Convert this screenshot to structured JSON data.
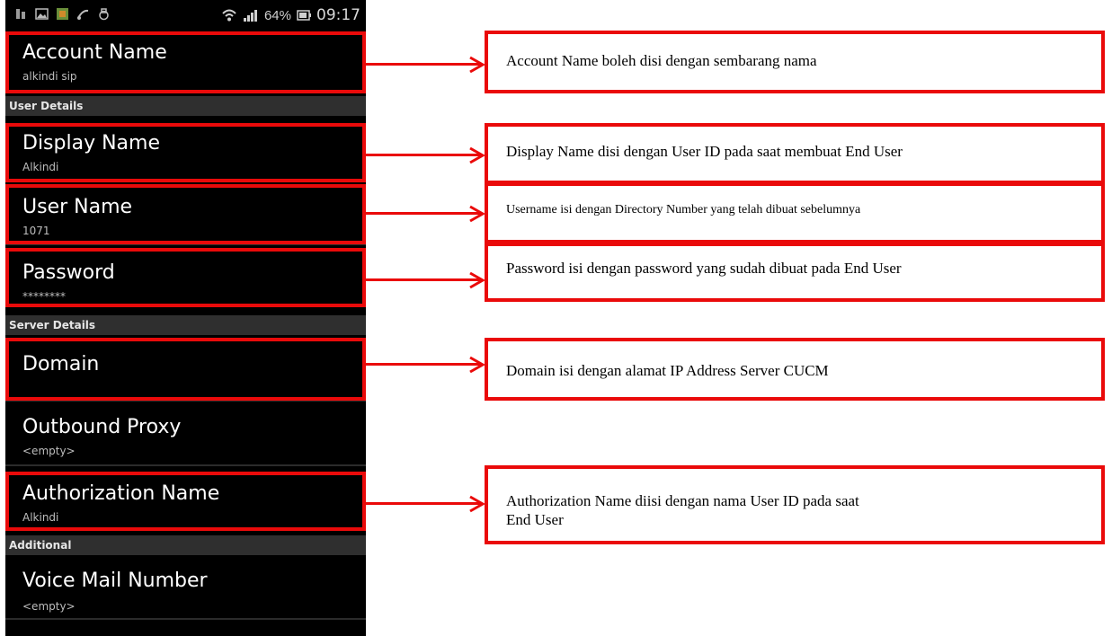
{
  "status_bar": {
    "battery_percent": "64%",
    "time": "09:17",
    "left_icons": [
      "notification-icon",
      "image-icon",
      "app-icon",
      "network-icon",
      "lock-icon"
    ]
  },
  "settings": {
    "account_name": {
      "title": "Account Name",
      "value": "alkindi sip"
    },
    "section_user": "User Details",
    "display_name": {
      "title": "Display Name",
      "value": "Alkindi"
    },
    "user_name": {
      "title": "User Name",
      "value": "1071"
    },
    "password": {
      "title": "Password",
      "value": "********"
    },
    "section_server": "Server Details",
    "domain": {
      "title": "Domain",
      "value": ""
    },
    "outbound_proxy": {
      "title": "Outbound Proxy",
      "value": "<empty>"
    },
    "authorization_name": {
      "title": "Authorization Name",
      "value": "Alkindi"
    },
    "section_additional": "Additional",
    "voice_mail": {
      "title": "Voice Mail Number",
      "value": "<empty>"
    }
  },
  "callouts": {
    "account_name": "Account Name boleh disi dengan sembarang nama",
    "display_name": "Display Name disi dengan User ID pada saat membuat End User",
    "user_name": "Username isi dengan Directory Number yang telah dibuat sebelumnya",
    "password": "Password isi dengan password yang sudah dibuat pada End User",
    "domain": "Domain isi dengan alamat IP Address Server CUCM",
    "authorization_name_line1": "Authorization Name diisi dengan nama User ID pada saat",
    "authorization_name_line2": "End User"
  },
  "colors": {
    "annotation_red": "#ea0a0a",
    "section_bg": "#2f2f2f"
  }
}
